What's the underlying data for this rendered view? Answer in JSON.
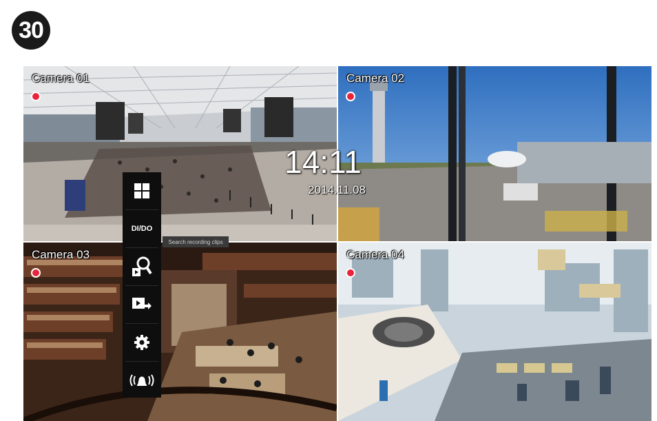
{
  "step_badge": "30",
  "cameras": [
    {
      "name": "Camera 01",
      "recording": true
    },
    {
      "name": "Camera 02",
      "recording": true
    },
    {
      "name": "Camera 03",
      "recording": true
    },
    {
      "name": "Camera 04",
      "recording": true
    }
  ],
  "overlay": {
    "time": "14:11",
    "date": "2014.11.08"
  },
  "toolbar": {
    "items": [
      {
        "icon": "layout-grid-icon"
      },
      {
        "label": "DI/DO"
      },
      {
        "icon": "search-playback-icon",
        "tooltip": "Search recording clips"
      },
      {
        "icon": "export-clip-icon"
      },
      {
        "icon": "gear-icon"
      },
      {
        "icon": "alarm-bell-icon"
      }
    ]
  },
  "colors": {
    "rec": "#e8243c",
    "toolbar": "#0e0e0e"
  }
}
